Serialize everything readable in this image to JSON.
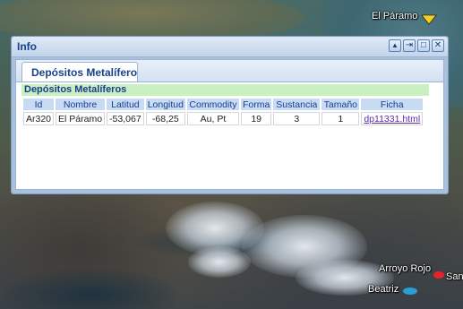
{
  "map": {
    "labels": {
      "el_paramo": "El Páramo",
      "arroyo_rojo": "Arroyo Rojo",
      "beatriz": "Beatriz",
      "san": "San"
    },
    "marker_colors": {
      "el_paramo": "#f2d21a",
      "arroyo_rojo": "#e8222a",
      "beatriz": "#2a9ed8"
    }
  },
  "window": {
    "title": "Info",
    "buttons": {
      "up": "▲",
      "dock": "⇥",
      "maximize": "□",
      "close": "✕"
    },
    "tab_label": "Depósitos Metalíferos",
    "group_header": "Depósitos Metalíferos",
    "table": {
      "columns": [
        "Id",
        "Nombre",
        "Latitud",
        "Longitud",
        "Commodity",
        "Forma",
        "Sustancia",
        "Tamaño",
        "Ficha"
      ],
      "rows": [
        [
          "Ar320",
          "El Páramo",
          "-53,067",
          "-68,25",
          "Au, Pt",
          "19",
          "3",
          "1",
          "dp11331.html"
        ]
      ]
    }
  }
}
